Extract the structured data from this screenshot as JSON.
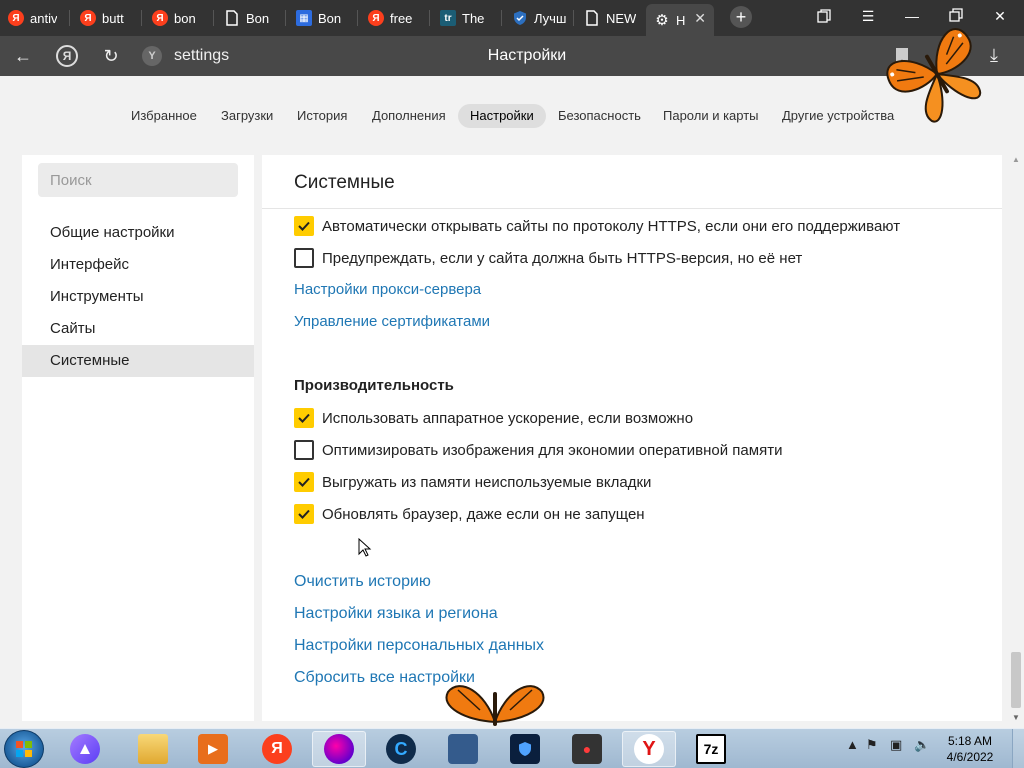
{
  "tabs": [
    {
      "label": "antiv",
      "icon": "yandex-icon"
    },
    {
      "label": "butt",
      "icon": "yandex-icon"
    },
    {
      "label": "bon",
      "icon": "yandex-icon"
    },
    {
      "label": "Bon",
      "icon": "document-icon"
    },
    {
      "label": "Bon",
      "icon": "mail-icon"
    },
    {
      "label": "free",
      "icon": "yandex-icon"
    },
    {
      "label": "The",
      "icon": "tr-icon"
    },
    {
      "label": "Лучш",
      "icon": "shield-icon"
    },
    {
      "label": "NEW",
      "icon": "document-icon"
    },
    {
      "label": "Н",
      "icon": "gear-icon"
    }
  ],
  "address": {
    "url": "settings",
    "page_title": "Настройки"
  },
  "nav": {
    "items": [
      "Избранное",
      "Загрузки",
      "История",
      "Дополнения",
      "Настройки",
      "Безопасность",
      "Пароли и карты",
      "Другие устройства"
    ],
    "active": "Настройки"
  },
  "sidebar": {
    "search_placeholder": "Поиск",
    "items": [
      "Общие настройки",
      "Интерфейс",
      "Инструменты",
      "Сайты",
      "Системные"
    ],
    "active": "Системные"
  },
  "panel": {
    "title": "Системные",
    "network_options": [
      {
        "label": "Автоматически открывать сайты по протоколу HTTPS, если они его поддерживают",
        "checked": true
      },
      {
        "label": "Предупреждать, если у сайта должна быть HTTPS-версия, но её нет",
        "checked": false
      }
    ],
    "network_links": [
      "Настройки прокси-сервера",
      "Управление сертификатами"
    ],
    "performance_title": "Производительность",
    "performance_options": [
      {
        "label": "Использовать аппаратное ускорение, если возможно",
        "checked": true
      },
      {
        "label": "Оптимизировать изображения для экономии оперативной памяти",
        "checked": false
      },
      {
        "label": "Выгружать из памяти неиспользуемые вкладки",
        "checked": true
      },
      {
        "label": "Обновлять браузер, даже если он не запущен",
        "checked": true
      }
    ],
    "bottom_links": [
      "Очистить историю",
      "Настройки языка и региона",
      "Настройки персональных данных",
      "Сбросить все настройки"
    ]
  },
  "taskbar": {
    "time": "5:18 AM",
    "date": "4/6/2022",
    "apps": [
      "alice-icon",
      "file-explorer-icon",
      "media-player-icon",
      "yandex-icon",
      "firefox-like-icon",
      "ccleaner-icon",
      "network-icon",
      "shield-icon",
      "screen-recorder-icon",
      "yandex-browser-icon",
      "7zip-icon"
    ],
    "sevenzip_label": "7z"
  },
  "colors": {
    "accent_checkbox": "#ffcc00",
    "link": "#1f77b4",
    "tabbar_bg": "#333333",
    "addressbar_bg": "#484848"
  }
}
